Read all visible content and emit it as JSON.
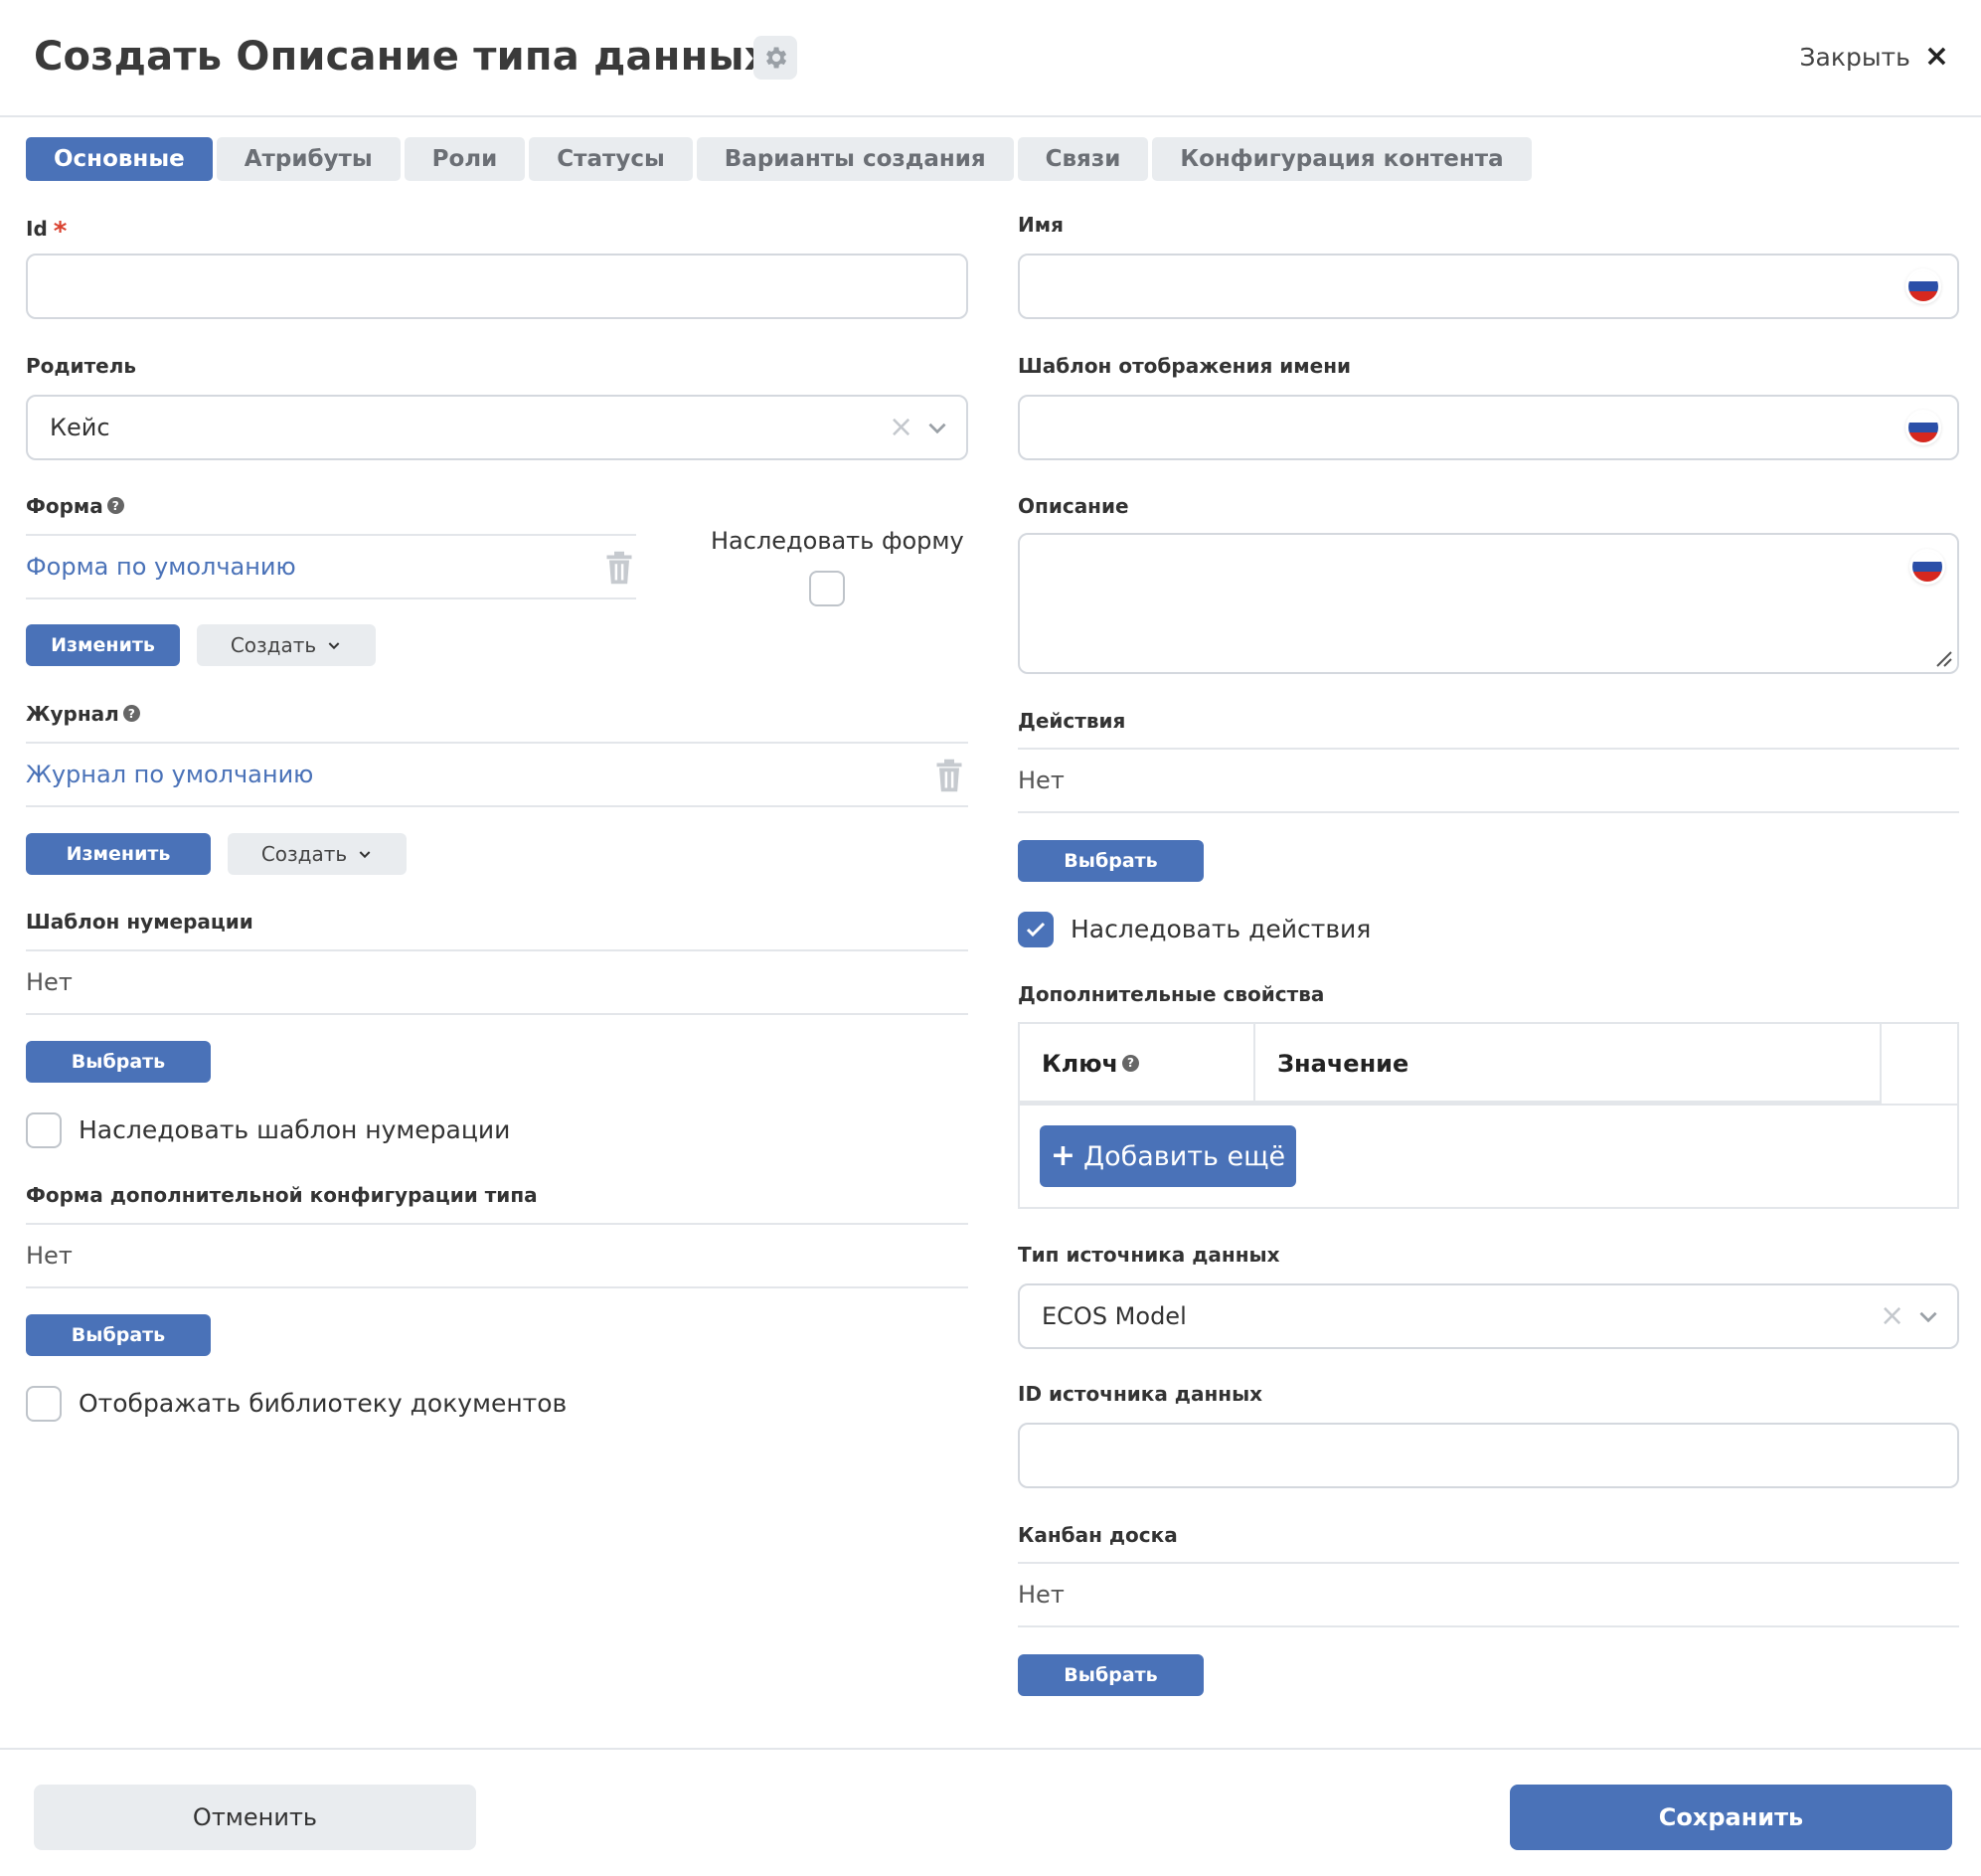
{
  "header": {
    "title": "Создать Описание типа данных",
    "close_label": "Закрыть",
    "close_icon": "×"
  },
  "tabs": [
    {
      "label": "Основные",
      "active": true
    },
    {
      "label": "Атрибуты"
    },
    {
      "label": "Роли"
    },
    {
      "label": "Статусы"
    },
    {
      "label": "Варианты создания"
    },
    {
      "label": "Связи"
    },
    {
      "label": "Конфигурация контента"
    }
  ],
  "left": {
    "id": {
      "label": "Id",
      "required_mark": "*",
      "value": ""
    },
    "parent": {
      "label": "Родитель",
      "value": "Кейс"
    },
    "form": {
      "label": "Форма",
      "value": "Форма по умолчанию",
      "change_label": "Изменить",
      "create_label": "Создать"
    },
    "inherit_form": {
      "label": "Наследовать форму",
      "checked": false
    },
    "journal": {
      "label": "Журнал",
      "value": "Журнал по умолчанию",
      "change_label": "Изменить",
      "create_label": "Создать"
    },
    "numbering": {
      "label": "Шаблон нумерации",
      "value": "Нет",
      "select_label": "Выбрать"
    },
    "inherit_numbering": {
      "label": "Наследовать шаблон нумерации",
      "checked": false
    },
    "config_form": {
      "label": "Форма дополнительной конфигурации типа",
      "value": "Нет",
      "select_label": "Выбрать"
    },
    "show_library": {
      "label": "Отображать библиотеку документов",
      "checked": false
    }
  },
  "right": {
    "name": {
      "label": "Имя",
      "value": ""
    },
    "name_template": {
      "label": "Шаблон отображения имени",
      "value": ""
    },
    "description": {
      "label": "Описание",
      "value": ""
    },
    "actions": {
      "label": "Действия",
      "value": "Нет",
      "select_label": "Выбрать"
    },
    "inherit_actions": {
      "label": "Наследовать действия",
      "checked": true
    },
    "extra_props": {
      "label": "Дополнительные свойства",
      "key_header": "Ключ",
      "value_header": "Значение",
      "add_label": "Добавить ещё"
    },
    "source_type": {
      "label": "Тип источника данных",
      "value": "ECOS Model"
    },
    "source_id": {
      "label": "ID источника данных",
      "value": ""
    },
    "kanban": {
      "label": "Канбан доска",
      "value": "Нет",
      "select_label": "Выбрать"
    }
  },
  "footer": {
    "cancel_label": "Отменить",
    "save_label": "Сохранить"
  },
  "colors": {
    "primary": "#4a72b8",
    "required": "#d9412f",
    "light_button": "#e9ecef"
  }
}
